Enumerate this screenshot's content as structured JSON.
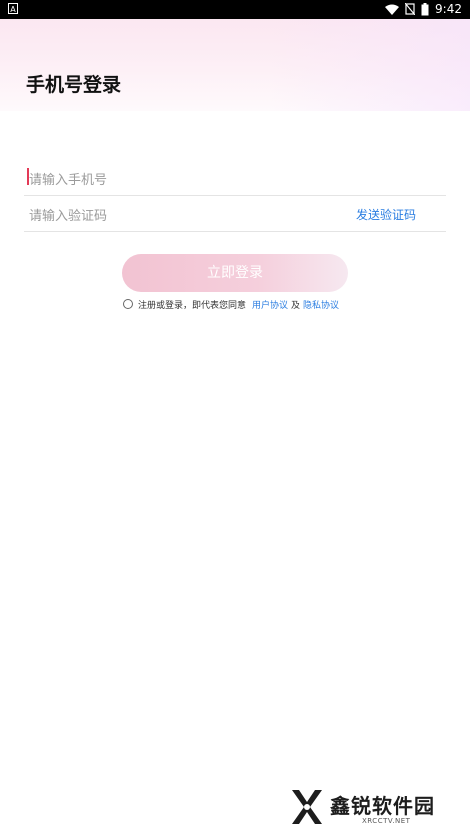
{
  "status_bar": {
    "left_icon": "A",
    "time": "9:42",
    "icons": [
      "wifi-icon",
      "no-sim-icon",
      "battery-icon"
    ]
  },
  "header": {
    "title": "手机号登录"
  },
  "form": {
    "phone_placeholder": "请输入手机号",
    "code_placeholder": "请输入验证码",
    "send_code_label": "发送验证码",
    "login_button": "立即登录"
  },
  "agreement": {
    "prefix": "注册或登录，即代表您同意",
    "user_agreement": "用户协议",
    "conjunction": "及",
    "privacy_agreement": "隐私协议"
  },
  "watermark": {
    "name": "鑫锐软件园",
    "site": "XRCCTV.NET"
  },
  "colors": {
    "accent_link": "#2a7de1",
    "button_start": "#f2c3d2",
    "caret": "#e33a57"
  }
}
